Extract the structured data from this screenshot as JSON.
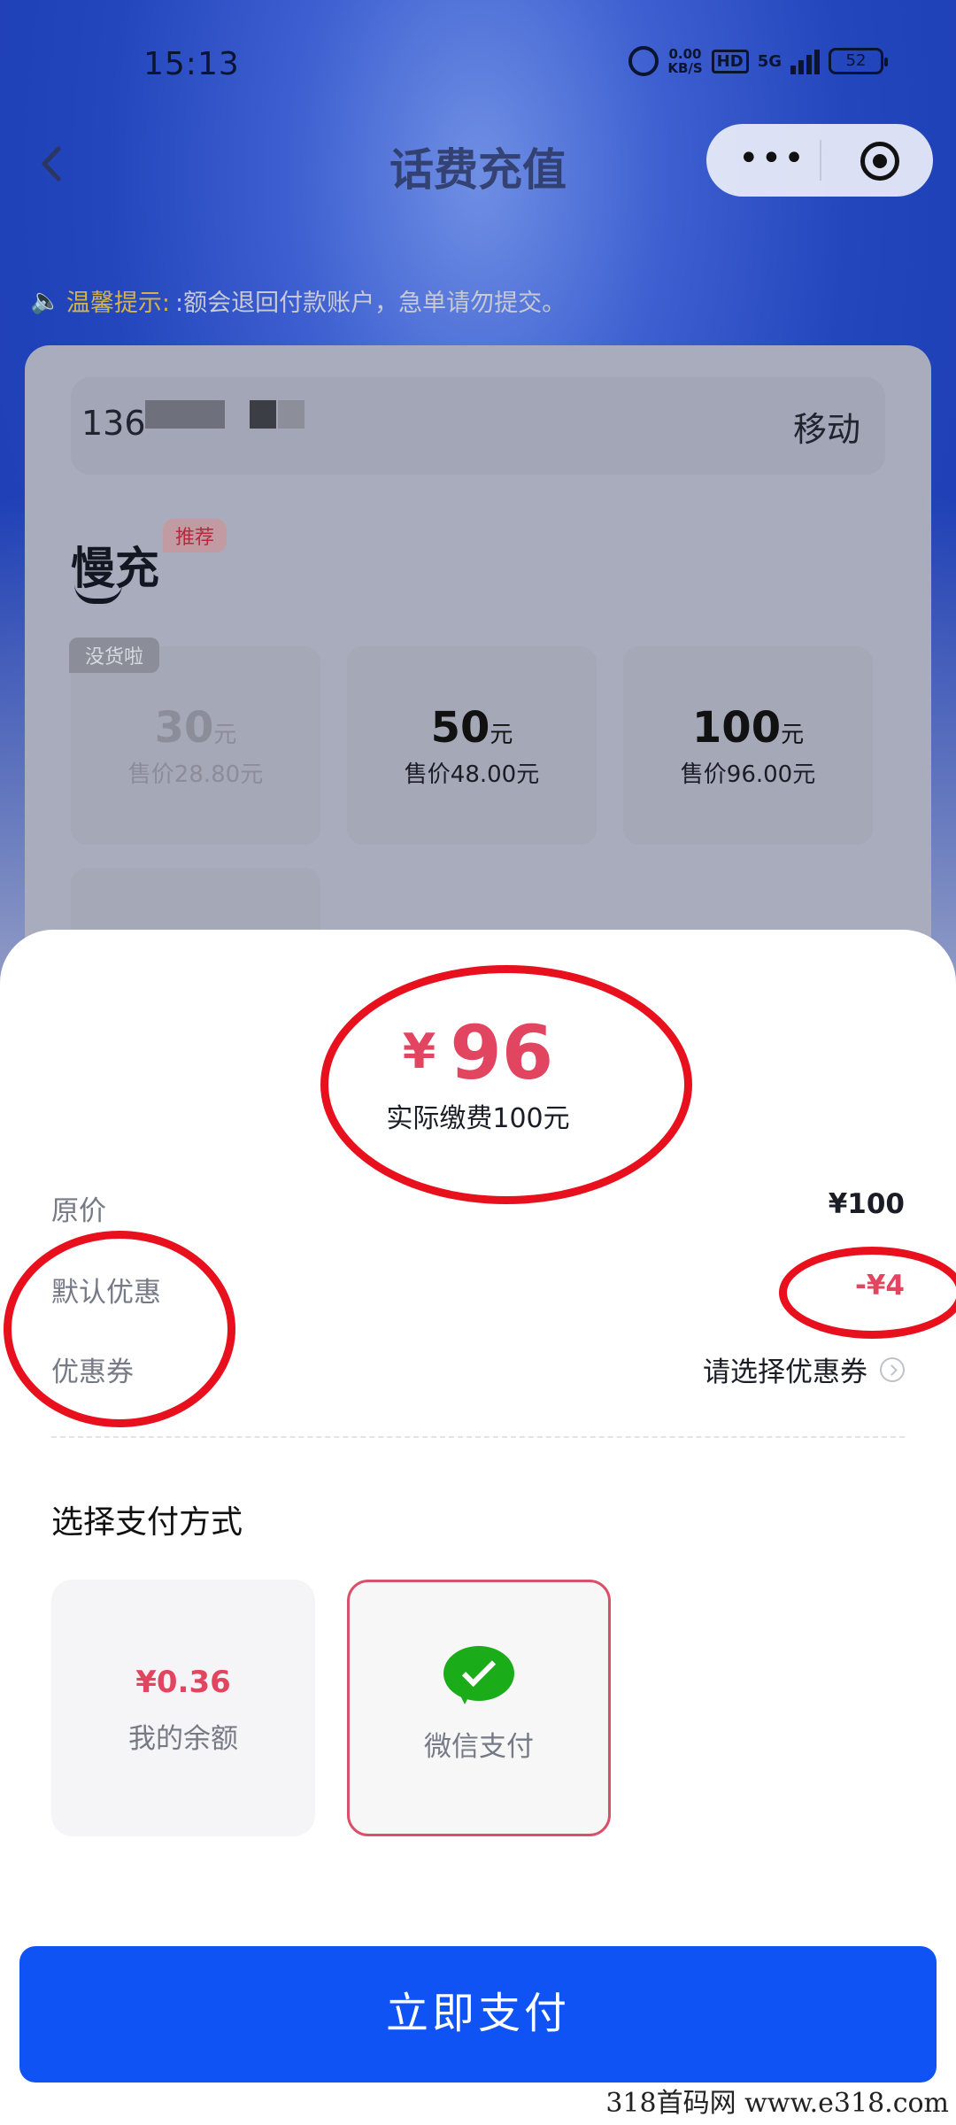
{
  "status_bar": {
    "time": "15:13",
    "net_speed": "0.00",
    "net_unit": "KB/S",
    "hd": "HD",
    "signal": "5G",
    "battery": "52"
  },
  "nav": {
    "title": "话费充值"
  },
  "notice": {
    "label": "温馨提示:",
    "text": ":额会退回付款账户，急单请勿提交。"
  },
  "account": {
    "phone": "136",
    "carrier": "移动"
  },
  "product": {
    "brand": "慢充",
    "tag": "推荐",
    "soldout_label": "没货啦",
    "options": [
      {
        "amount": "30",
        "unit": "元",
        "price": "售价28.80元"
      },
      {
        "amount": "50",
        "unit": "元",
        "price": "售价48.00元"
      },
      {
        "amount": "100",
        "unit": "元",
        "price": "售价96.00元"
      }
    ]
  },
  "sheet": {
    "currency": "¥",
    "price": "96",
    "actual": "实际缴费100元",
    "rows": {
      "original_label": "原价",
      "original_value": "¥100",
      "discount_label": "默认优惠",
      "discount_value": "-¥4",
      "coupon_label": "优惠券",
      "coupon_value": "请选择优惠券"
    },
    "section_title": "选择支付方式",
    "methods": [
      {
        "value": "¥0.36",
        "label": "我的余额"
      },
      {
        "label": "微信支付",
        "selected": true
      }
    ],
    "pay_button": "立即支付"
  },
  "watermark": "318首码网  www.e318.com",
  "colors": {
    "accent_red": "#e2455f",
    "primary_blue": "#1053f5",
    "wechat_green": "#1aad19",
    "annotation_red": "#e8101d"
  }
}
